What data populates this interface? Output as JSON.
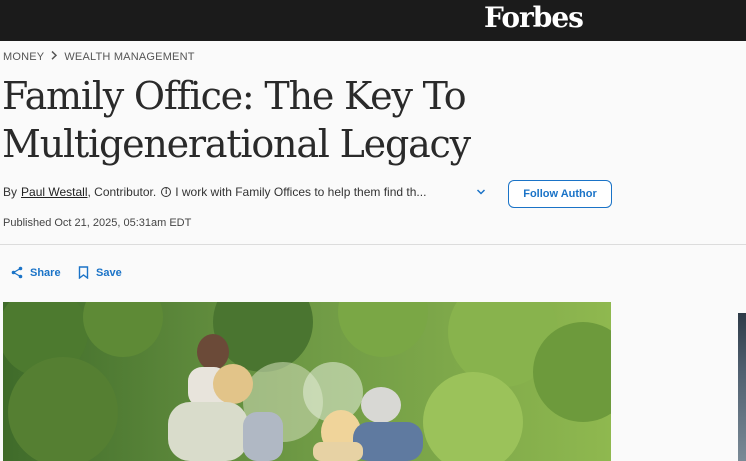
{
  "brand": {
    "logo_text": "Forbes"
  },
  "breadcrumb": {
    "items": [
      "MONEY",
      "WEALTH MANAGEMENT"
    ]
  },
  "article": {
    "headline": "Family Office: The Key To Multigenerational Legacy",
    "byline": {
      "prefix": "By",
      "author": "Paul Westall",
      "role": ", Contributor.",
      "bio": "I work with Family Offices to help them find th...",
      "follow_label": "Follow Author"
    },
    "published": "Published Oct 21, 2025, 05:31am EDT"
  },
  "actions": {
    "share_label": "Share",
    "save_label": "Save"
  },
  "colors": {
    "topbar": "#1b1b1b",
    "accent": "#1a73c7",
    "text": "#222222"
  },
  "icons": [
    "share-icon",
    "bookmark-icon",
    "info-icon",
    "chevron-down-icon",
    "chevron-right-icon"
  ]
}
